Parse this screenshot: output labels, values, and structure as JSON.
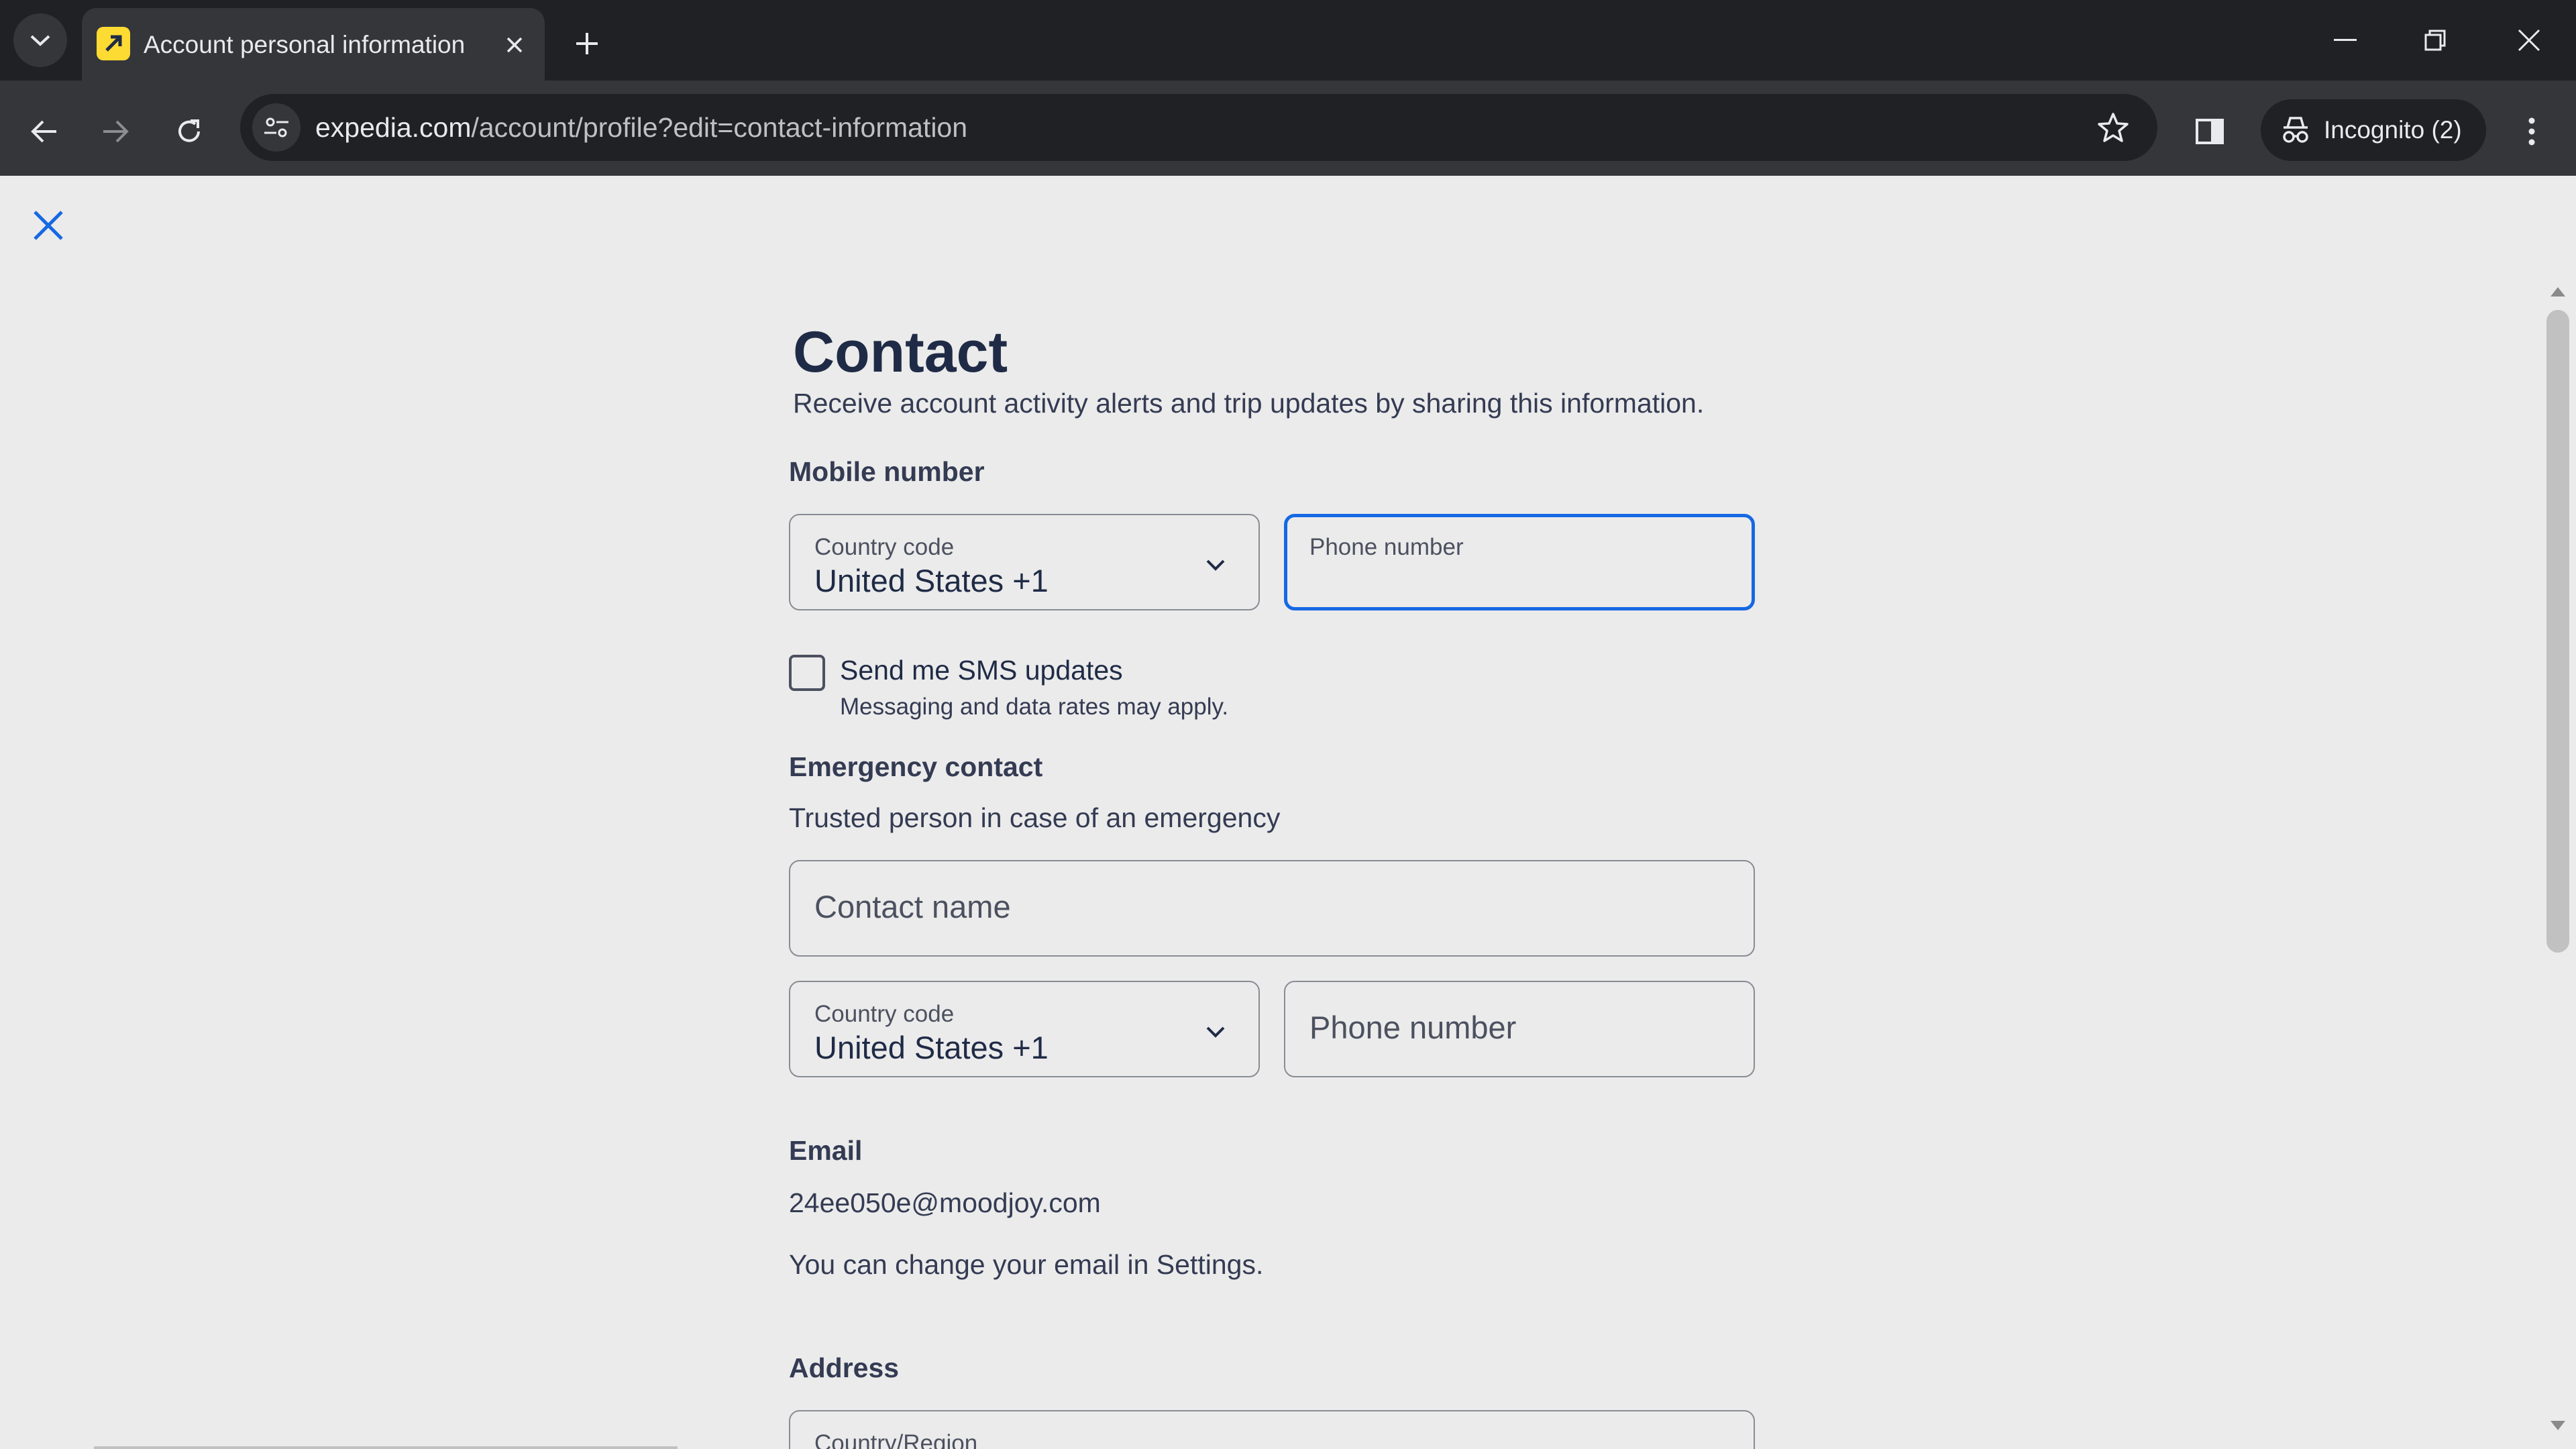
{
  "browser": {
    "tab_title": "Account personal information",
    "url_host": "expedia.com",
    "url_path": "/account/profile?edit=contact-information",
    "incognito_label": "Incognito (2)",
    "icons": [
      "tab-search-icon",
      "close-icon",
      "plus-icon",
      "minimize-icon",
      "restore-icon",
      "back-icon",
      "forward-icon",
      "reload-icon",
      "site-settings-icon",
      "star-icon",
      "side-panel-icon",
      "incognito-icon",
      "more-vert-icon"
    ]
  },
  "page": {
    "title": "Contact",
    "subtitle": "Receive account activity alerts and trip updates by sharing this information.",
    "mobile": {
      "section_label": "Mobile number",
      "country_code_label": "Country code",
      "country_code_value": "United States +1",
      "phone_label": "Phone number",
      "sms_label": "Send me SMS updates",
      "sms_hint": "Messaging and data rates may apply.",
      "sms_checked": false
    },
    "emergency": {
      "section_label": "Emergency contact",
      "description": "Trusted person in case of an emergency",
      "contact_name_placeholder": "Contact name",
      "country_code_label": "Country code",
      "country_code_value": "United States +1",
      "phone_placeholder": "Phone number"
    },
    "email": {
      "section_label": "Email",
      "value": "24ee050e@moodjoy.com",
      "note": "You can change your email in Settings."
    },
    "address": {
      "section_label": "Address",
      "field_placeholder": "Country/Region"
    }
  },
  "colors": {
    "accent": "#1668e3",
    "heading": "#1f2b46",
    "page_bg": "#ebebeb",
    "chrome_dark": "#202124",
    "chrome_toolbar": "#35363a"
  }
}
